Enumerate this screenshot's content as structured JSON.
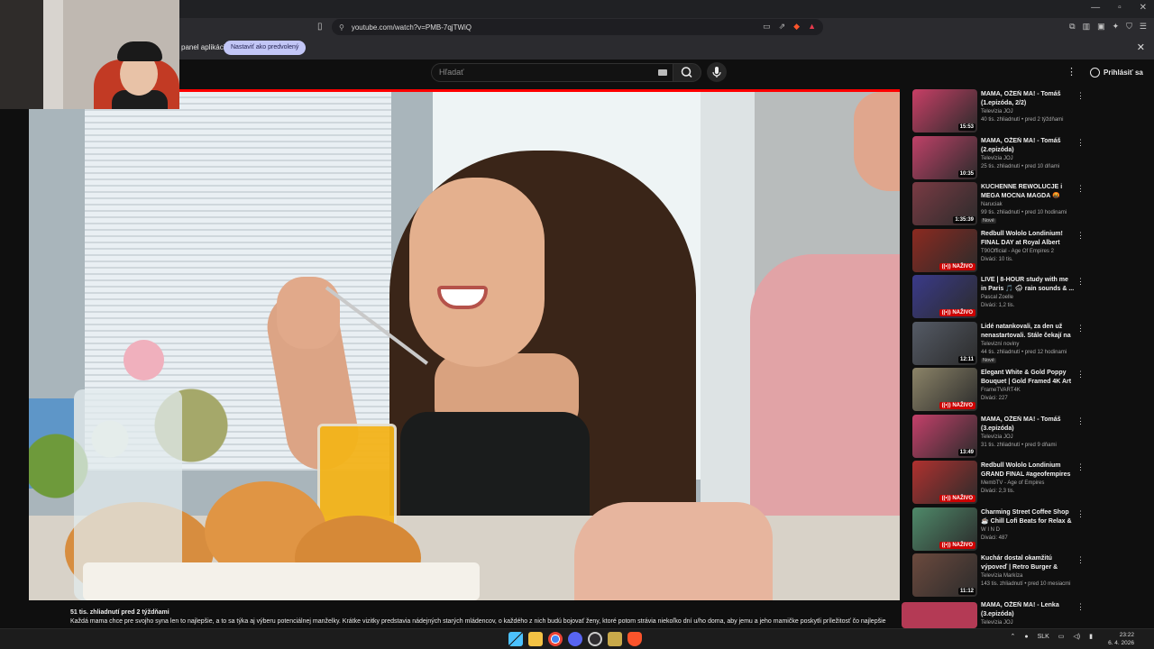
{
  "browser": {
    "url": "youtube.com/watch?v=PMB-7qjTWiQ",
    "infobar_text": "panel aplikácií",
    "infobar_button": "Nastaviť ako predvolený"
  },
  "youtube": {
    "search_placeholder": "Hľadať",
    "signin_label": "Prihlásiť sa"
  },
  "video": {
    "meta": "51 tis. zhliadnutí  pred 2 týždňami",
    "description": "Každá mama chce pre svojho syna len to najlepšie, a to sa týka aj výberu potenciálnej manželky. Krátke vizitky predstavia nádejných starých mládencov, o každého z nich budú bojovať ženy, ktoré potom strávia niekoľko dní u/ho doma, aby jemu a jeho mamičke poskytli príležitosť čo najlepšie"
  },
  "recommendations": [
    {
      "title": "MAMA, OŽEŇ MA! - Tomáš (1.epizóda, 2/2)",
      "channel": "Televízia JOJ",
      "meta": "40 tis. zhliadnutí • pred 2 týždňami",
      "duration": "15:53",
      "live": false,
      "badge": "",
      "color": "#c83f66"
    },
    {
      "title": "MAMA, OŽEŇ MA! - Tomáš (2.epizóda)",
      "channel": "Televízia JOJ",
      "meta": "25 tis. zhliadnutí • pred 10 dňami",
      "duration": "10:35",
      "live": false,
      "badge": "",
      "color": "#bf4168"
    },
    {
      "title": "KUCHENNE REWOLUCJE i MEGA MOCNA MAGDA 🤬",
      "channel": "Naruciak",
      "meta": "99 tis. zhliadnutí • pred 10 hodinami",
      "duration": "1:35:39",
      "live": false,
      "badge": "Nové",
      "color": "#7a3b44"
    },
    {
      "title": "Redbull Wololo Londinium! FINAL DAY at Royal Albert Hall!",
      "channel": "T90Official - Age Of Empires 2",
      "meta": "Diváci: 10 tis.",
      "duration": "NAŽIVO",
      "live": true,
      "badge": "",
      "color": "#8c2a20"
    },
    {
      "title": "LIVE | 8-HOUR study with me in Paris 🎵 🌧 rain sounds & ...",
      "channel": "Pascal Zoelle",
      "meta": "Diváci: 1,2 tis.",
      "duration": "NAŽIVO",
      "live": true,
      "badge": "",
      "color": "#3a3a8a"
    },
    {
      "title": "Lidé natankovali, za den už nenastartovali. Stále čekají na ...",
      "channel": "Televizní noviny",
      "meta": "44 tis. zhliadnutí • pred 12 hodinami",
      "duration": "12:11",
      "live": false,
      "badge": "Nové",
      "color": "#555b66"
    },
    {
      "title": "Elegant White & Gold Poppy Bouquet | Gold Framed 4K Art ...",
      "channel": "FrameTVART4K",
      "meta": "Diváci: 227",
      "duration": "NAŽIVO",
      "live": true,
      "badge": "",
      "color": "#8c8468"
    },
    {
      "title": "MAMA, OŽEŇ MA! - Tomáš (3.epizóda)",
      "channel": "Televízia JOJ",
      "meta": "31 tis. zhliadnutí • pred 9 dňami",
      "duration": "13:49",
      "live": false,
      "badge": "",
      "color": "#c4406a"
    },
    {
      "title": "Redbull Wololo Londinium GRAND FINAL #ageofempires",
      "channel": "MembTV - Age of Empires",
      "meta": "Diváci: 2,3 tis.",
      "duration": "NAŽIVO",
      "live": true,
      "badge": "",
      "color": "#b0312f"
    },
    {
      "title": "Charming Street Coffee Shop ☕ Chill Lofi Beats for Relax & ...",
      "channel": "W I N D",
      "meta": "Diváci: 487",
      "duration": "NAŽIVO",
      "live": true,
      "badge": "",
      "color": "#4f8a6a"
    },
    {
      "title": "Kuchár dostal okamžitú výpoveď | Retro Burger & Dinn...",
      "channel": "Televízia Markíza",
      "meta": "143 tis. zhliadnutí • pred 10 mesiacmi",
      "duration": "11:12",
      "live": false,
      "badge": "",
      "color": "#6c4a3e"
    },
    {
      "title": "MAMA, OŽEŇ MA! - Lenka (3.epizóda)",
      "channel": "Televízia JOJ",
      "meta": "",
      "duration": "",
      "live": false,
      "badge": "",
      "color": "#b83f66"
    }
  ],
  "taskbar": {
    "lang": "SLK",
    "time": "23:22",
    "date": "6. 4. 2026"
  },
  "colors": {
    "accent_red": "#ff0000",
    "infobar_button_bg": "#c2c6f6"
  }
}
